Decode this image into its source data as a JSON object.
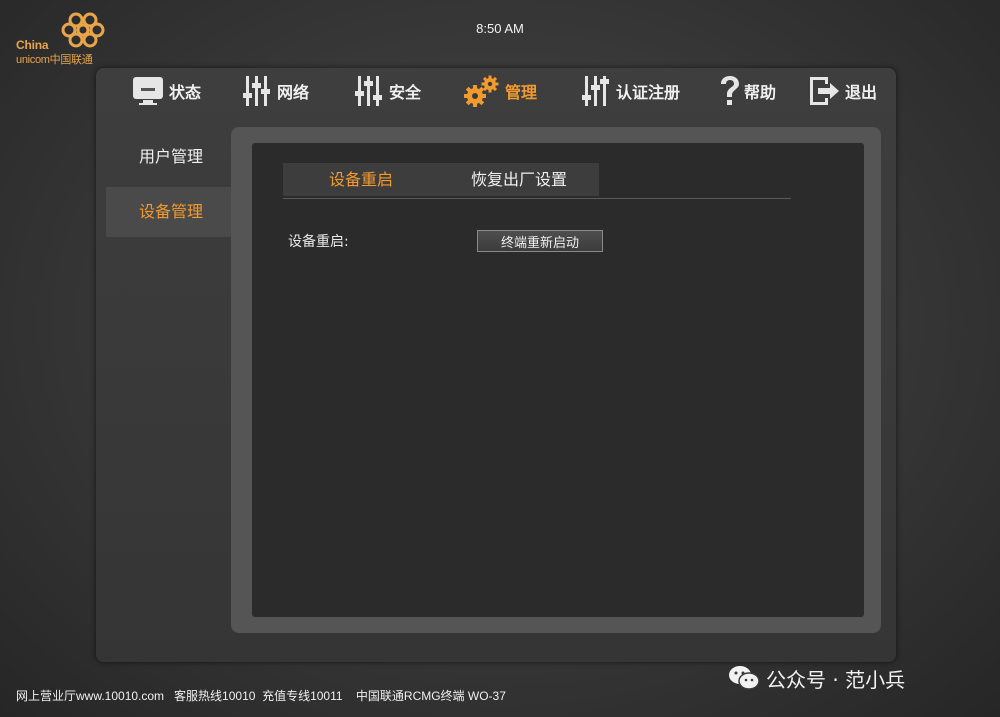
{
  "header": {
    "logo_line1": "China",
    "logo_line2": "unicom中国联通",
    "clock": "8:50 AM"
  },
  "nav": [
    {
      "label": "状态",
      "icon": "monitor-icon"
    },
    {
      "label": "网络",
      "icon": "sliders-icon"
    },
    {
      "label": "安全",
      "icon": "sliders-icon"
    },
    {
      "label": "管理",
      "icon": "gears-icon",
      "active": true
    },
    {
      "label": "认证注册",
      "icon": "sliders-icon"
    },
    {
      "label": "帮助",
      "icon": "question-icon"
    },
    {
      "label": "退出",
      "icon": "exit-icon"
    }
  ],
  "sidebar": {
    "items": [
      {
        "label": "用户管理"
      },
      {
        "label": "设备管理",
        "selected": true
      }
    ]
  },
  "tabs": [
    {
      "label": "设备重启",
      "active": true
    },
    {
      "label": "恢复出厂设置"
    }
  ],
  "form": {
    "reboot_label": "设备重启:",
    "reboot_button": "终端重新启动"
  },
  "footer": {
    "text": "网上营业厅www.10010.com   客服热线10010  充值专线10011    中国联通RCMG终端 WO-37"
  },
  "watermark": {
    "text": "公众号 · 范小兵",
    "logo": "范小兵"
  },
  "colors": {
    "accent": "#f39a2e",
    "panel": "#3a3a3a",
    "content_bg": "#2b2b2b"
  }
}
